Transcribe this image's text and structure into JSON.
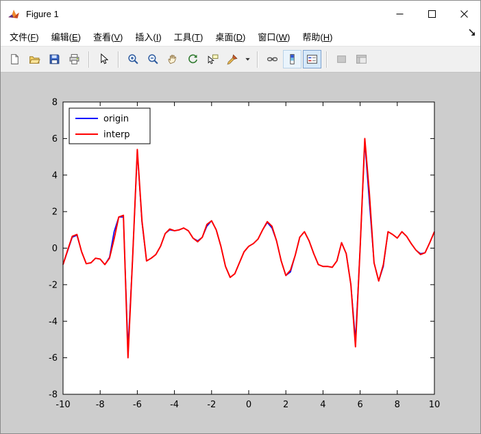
{
  "window": {
    "title": "Figure 1",
    "controls": [
      "minimize",
      "maximize",
      "close"
    ]
  },
  "menu": {
    "items": [
      {
        "label": "文件(F)"
      },
      {
        "label": "编辑(E)"
      },
      {
        "label": "查看(V)"
      },
      {
        "label": "插入(I)"
      },
      {
        "label": "工具(T)"
      },
      {
        "label": "桌面(D)"
      },
      {
        "label": "窗口(W)"
      },
      {
        "label": "帮助(H)"
      }
    ]
  },
  "toolbar": {
    "buttons": [
      {
        "name": "new-figure"
      },
      {
        "name": "open-file"
      },
      {
        "name": "save-figure"
      },
      {
        "name": "print-figure"
      },
      {
        "name": "edit-plot"
      },
      {
        "name": "zoom-in"
      },
      {
        "name": "zoom-out"
      },
      {
        "name": "pan"
      },
      {
        "name": "rotate-3d"
      },
      {
        "name": "data-cursor"
      },
      {
        "name": "brush"
      },
      {
        "name": "link-plot"
      },
      {
        "name": "insert-colorbar"
      },
      {
        "name": "insert-legend"
      },
      {
        "name": "hide-plot-tools"
      },
      {
        "name": "show-plot-tools"
      }
    ]
  },
  "chart_data": {
    "type": "line",
    "title": "",
    "xlabel": "",
    "ylabel": "",
    "xlim": [
      -10,
      10
    ],
    "ylim": [
      -8,
      8
    ],
    "xticks": [
      -10,
      -8,
      -6,
      -4,
      -2,
      0,
      2,
      4,
      6,
      8,
      10
    ],
    "yticks": [
      -8,
      -6,
      -4,
      -2,
      0,
      2,
      4,
      6,
      8
    ],
    "grid": false,
    "background": "#ffffff",
    "legend": {
      "position": "top-left",
      "entries": [
        {
          "label": "origin",
          "color": "#0000ff"
        },
        {
          "label": "interp",
          "color": "#ff0000"
        }
      ]
    },
    "x": [
      -10,
      -9.75,
      -9.5,
      -9.25,
      -9,
      -8.75,
      -8.5,
      -8.25,
      -8,
      -7.75,
      -7.5,
      -7.25,
      -7,
      -6.75,
      -6.5,
      -6.25,
      -6,
      -5.75,
      -5.5,
      -5.25,
      -5,
      -4.75,
      -4.5,
      -4.25,
      -4,
      -3.75,
      -3.5,
      -3.25,
      -3,
      -2.75,
      -2.5,
      -2.25,
      -2,
      -1.75,
      -1.5,
      -1.25,
      -1,
      -0.75,
      -0.5,
      -0.25,
      0,
      0.25,
      0.5,
      0.75,
      1,
      1.25,
      1.5,
      1.75,
      2,
      2.25,
      2.5,
      2.75,
      3,
      3.25,
      3.5,
      3.75,
      4,
      4.25,
      4.5,
      4.75,
      5,
      5.25,
      5.5,
      5.75,
      6,
      6.25,
      6.5,
      6.75,
      7,
      7.25,
      7.5,
      7.75,
      8,
      8.25,
      8.5,
      8.75,
      9,
      9.25,
      9.5,
      9.75,
      10
    ],
    "series": [
      {
        "name": "origin",
        "color": "#0000ff",
        "width": 1.6,
        "values": [
          -0.9,
          -0.15,
          0.6,
          0.7,
          -0.2,
          -0.85,
          -0.8,
          -0.55,
          -0.6,
          -0.9,
          -0.5,
          0.9,
          1.7,
          1.7,
          -5.5,
          -0.5,
          5.3,
          1.4,
          -0.7,
          -0.55,
          -0.35,
          0.1,
          0.8,
          1.0,
          0.95,
          1.0,
          1.1,
          0.95,
          0.55,
          0.4,
          0.6,
          1.2,
          1.5,
          1.0,
          0.1,
          -1.0,
          -1.6,
          -1.4,
          -0.8,
          -0.2,
          0.1,
          0.25,
          0.5,
          1.0,
          1.4,
          1.1,
          0.4,
          -0.7,
          -1.5,
          -1.3,
          -0.4,
          0.6,
          0.9,
          0.4,
          -0.3,
          -0.9,
          -1.0,
          -1.0,
          -1.05,
          -0.7,
          0.3,
          -0.3,
          -2.0,
          -5.0,
          0.0,
          5.8,
          2.5,
          -0.8,
          -1.8,
          -1.0,
          0.9,
          0.75,
          0.55,
          0.9,
          0.65,
          0.25,
          -0.1,
          -0.3,
          -0.25,
          0.3,
          0.9
        ]
      },
      {
        "name": "interp",
        "color": "#ff0000",
        "width": 2,
        "values": [
          -0.9,
          -0.1,
          0.65,
          0.75,
          -0.2,
          -0.85,
          -0.8,
          -0.55,
          -0.6,
          -0.9,
          -0.55,
          0.5,
          1.7,
          1.8,
          -6.0,
          -0.5,
          5.4,
          1.5,
          -0.7,
          -0.55,
          -0.35,
          0.1,
          0.8,
          1.05,
          0.95,
          1.0,
          1.1,
          0.95,
          0.55,
          0.35,
          0.6,
          1.3,
          1.5,
          1.0,
          0.1,
          -1.0,
          -1.6,
          -1.4,
          -0.8,
          -0.2,
          0.1,
          0.25,
          0.5,
          1.0,
          1.45,
          1.2,
          0.4,
          -0.7,
          -1.5,
          -1.2,
          -0.4,
          0.6,
          0.9,
          0.4,
          -0.3,
          -0.9,
          -1.0,
          -1.0,
          -1.05,
          -0.7,
          0.3,
          -0.3,
          -2.0,
          -5.4,
          0.0,
          6.0,
          3.0,
          -0.8,
          -1.8,
          -0.9,
          0.9,
          0.75,
          0.55,
          0.9,
          0.65,
          0.25,
          -0.1,
          -0.35,
          -0.25,
          0.3,
          0.9
        ]
      }
    ]
  }
}
